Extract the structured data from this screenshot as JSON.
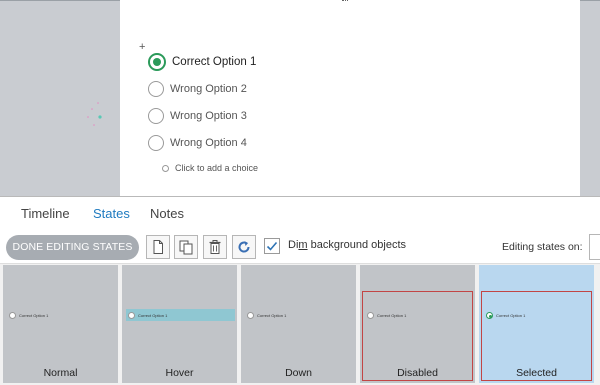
{
  "slide": {
    "options": [
      {
        "label": "Correct Option 1",
        "selected": true
      },
      {
        "label": "Wrong Option 2",
        "selected": false
      },
      {
        "label": "Wrong Option 3",
        "selected": false
      },
      {
        "label": "Wrong Option 4",
        "selected": false
      }
    ],
    "add_choice": "Click to add a choice",
    "plus_glyph": "+"
  },
  "panel": {
    "tabs": [
      {
        "label": "Timeline",
        "active": false
      },
      {
        "label": "States",
        "active": true
      },
      {
        "label": "Notes",
        "active": false
      }
    ],
    "toolbar": {
      "done_label": "DONE EDITING STATES",
      "tool_icons": [
        "new-state-icon",
        "duplicate-state-icon",
        "delete-state-icon",
        "reset-state-icon"
      ],
      "dim_checked": true,
      "dim_label": "Dim background objects",
      "editing_label": "Editing states on:"
    },
    "states": [
      {
        "name": "Normal",
        "preview_text": "Correct Option 1",
        "selected_radio": false
      },
      {
        "name": "Hover",
        "preview_text": "Correct Option 1",
        "selected_radio": false
      },
      {
        "name": "Down",
        "preview_text": "Correct Option 1",
        "selected_radio": false
      },
      {
        "name": "Disabled",
        "preview_text": "Correct Option 1",
        "selected_radio": false
      },
      {
        "name": "Selected",
        "preview_text": "Correct Option 1",
        "selected_radio": true
      }
    ]
  },
  "colors": {
    "accent": "#1f7bc0",
    "radio_selected": "#2b9a5a",
    "disabled_border": "#c24545",
    "selected_card": "#b9d7ef",
    "done_button": "#a7acb2"
  }
}
